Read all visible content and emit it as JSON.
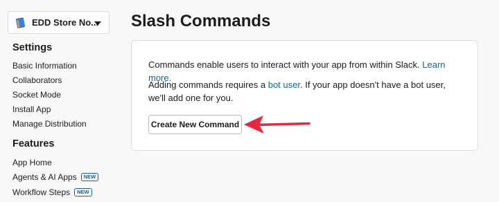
{
  "sidebar": {
    "app_name": "EDD Store No...",
    "app_icon": "book-icon",
    "sections": [
      {
        "heading": "Settings",
        "items": [
          {
            "label": "Basic Information"
          },
          {
            "label": "Collaborators"
          },
          {
            "label": "Socket Mode"
          },
          {
            "label": "Install App"
          },
          {
            "label": "Manage Distribution"
          }
        ]
      },
      {
        "heading": "Features",
        "items": [
          {
            "label": "App Home"
          },
          {
            "label": "Agents & AI Apps",
            "badge": "NEW"
          },
          {
            "label": "Workflow Steps",
            "badge": "NEW"
          }
        ]
      }
    ]
  },
  "main": {
    "title": "Slash Commands",
    "card": {
      "para1": "Commands enable users to interact with your app from within Slack.",
      "learn_more": "Learn more.",
      "para2_before": "Adding commands requires a",
      "bot_user_link": "bot user",
      "para2_after": ". If your app doesn't have a bot user, we'll add one for you.",
      "button_label": "Create New Command"
    }
  },
  "colors": {
    "link": "#1264a3",
    "arrow": "#e8283c",
    "background": "#f8f8f8"
  }
}
